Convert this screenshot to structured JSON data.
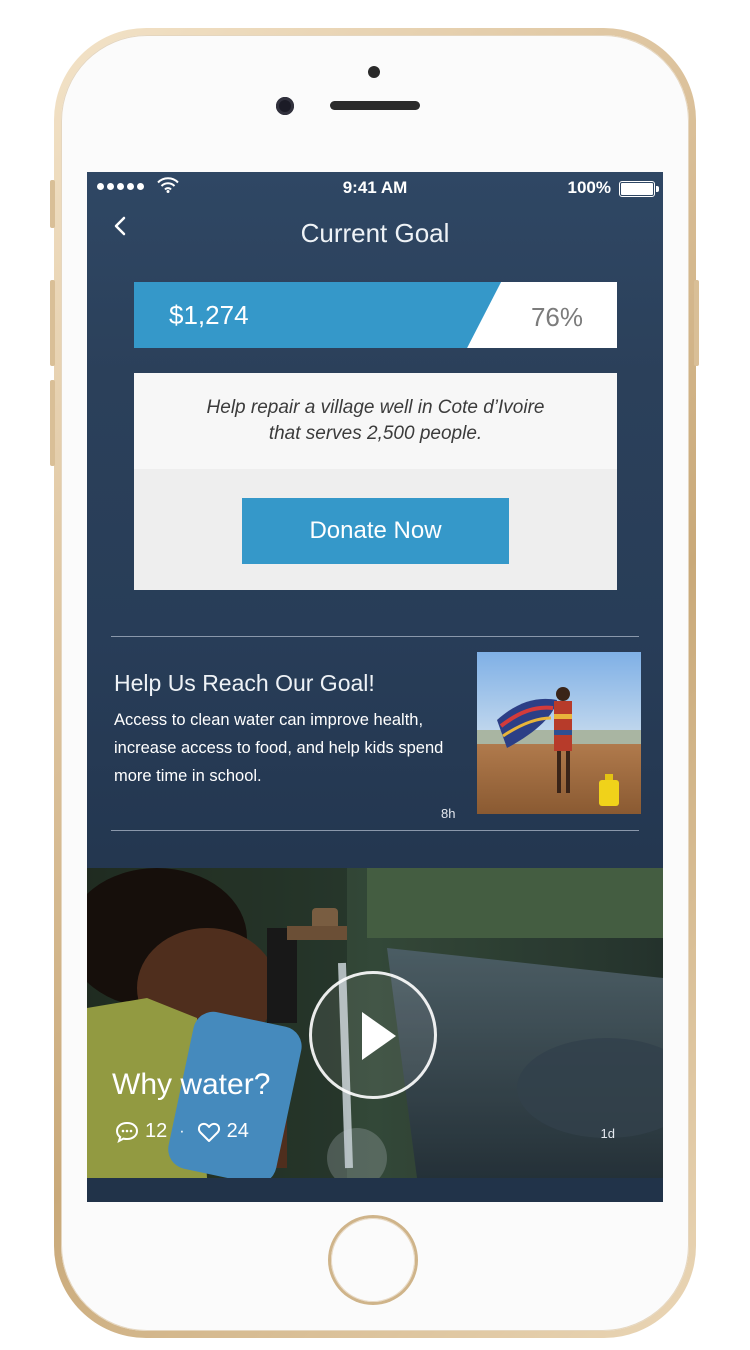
{
  "status_bar": {
    "time": "9:41 AM",
    "battery": "100%"
  },
  "nav": {
    "back_icon": "chevron-left-icon",
    "title": "Current Goal"
  },
  "progress": {
    "amount": "$1,274",
    "percent": "76%",
    "fraction": 0.76,
    "fill_color": "#3598c9"
  },
  "goal": {
    "description_line1": "Help repair a village well in Cote d’Ivoire",
    "description_line2": "that serves 2,500 people.",
    "donate_label": "Donate Now"
  },
  "feed_item": {
    "title": "Help Us Reach Our Goal!",
    "body": "Access to clean water can improve health, increase access to food, and help kids spend more time in school.",
    "time": "8h"
  },
  "video_post": {
    "title": "Why water?",
    "comments": "12",
    "separator": "·",
    "likes": "24",
    "time": "1d"
  },
  "colors": {
    "accent": "#3598c9",
    "screen_bg": "#2b405a"
  }
}
